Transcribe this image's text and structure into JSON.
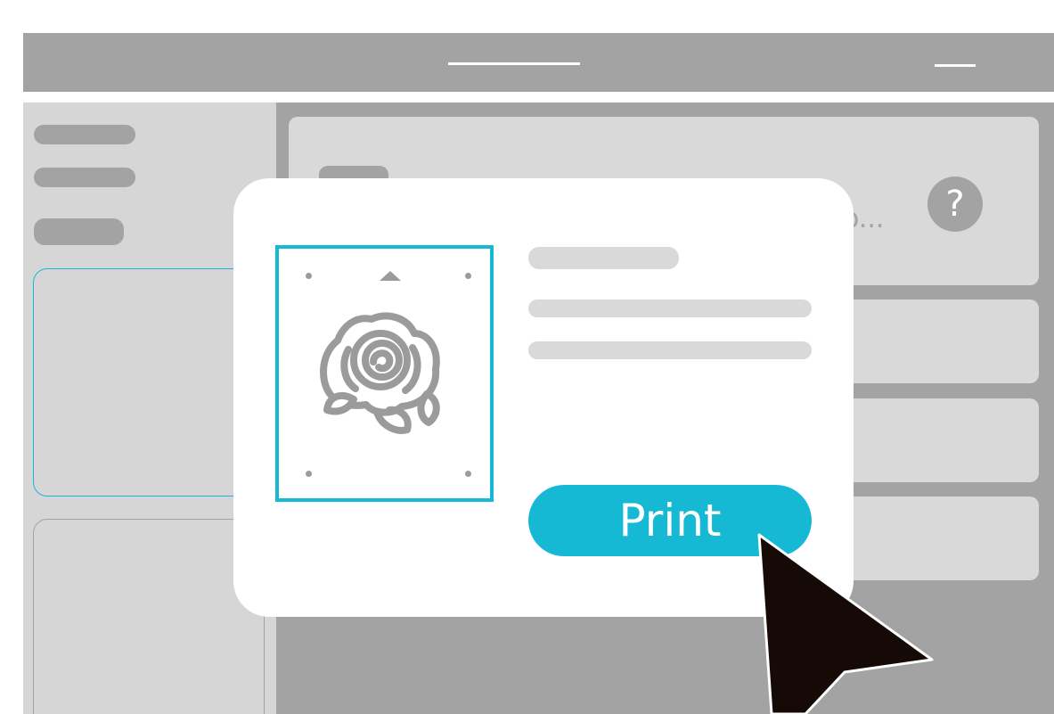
{
  "dialog": {
    "print_label": "Print"
  },
  "header": {
    "help_icon_glyph": "?",
    "truncated_text": "o..."
  },
  "colors": {
    "accent": "#16b9d4",
    "chrome_gray": "#a3a3a4",
    "panel_gray": "#d9d9d9",
    "cursor": "#150a05"
  },
  "icons": [
    "help-icon",
    "rose-icon",
    "orientation-arrow-icon",
    "cursor-arrow-icon",
    "minimize-icon"
  ]
}
